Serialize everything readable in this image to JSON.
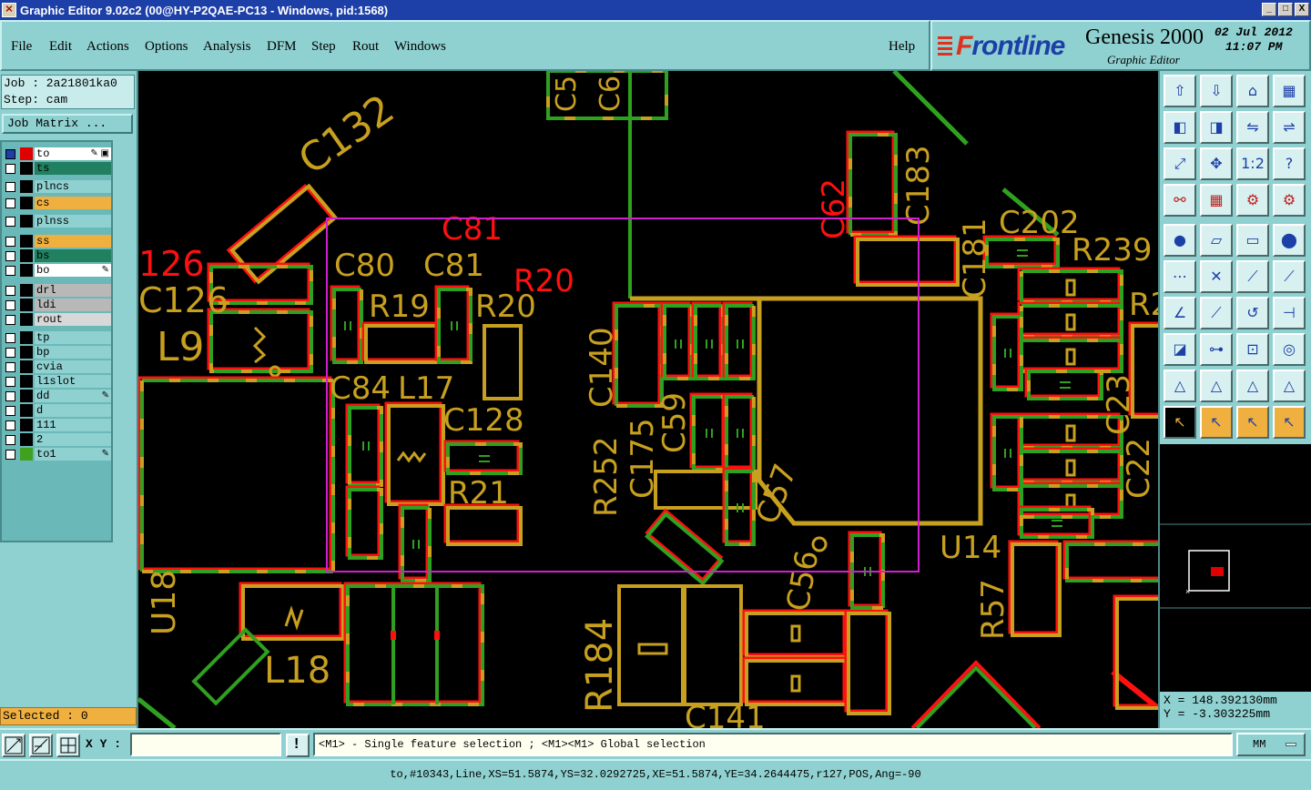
{
  "window": {
    "title": "Graphic Editor 9.02c2 (00@HY-P2QAE-PC13 - Windows, pid:1568)",
    "buttons": [
      "_",
      "□",
      "X"
    ]
  },
  "menu": {
    "file": "File",
    "edit": "Edit",
    "actions": "Actions",
    "options": "Options",
    "analysis": "Analysis",
    "dfm": "DFM",
    "step": "Step",
    "rout": "Rout",
    "windows": "Windows",
    "help": "Help"
  },
  "logo": {
    "brand_f": "F",
    "brand_rest": "rontline",
    "product": "Genesis 2000",
    "subtitle": "Graphic Editor",
    "date": "02 Jul 2012",
    "time": "11:07 PM"
  },
  "job": {
    "job_line": "Job : 2a21801ka0",
    "step_line": "Step: cam",
    "matrix_button": "Job Matrix ..."
  },
  "layers": [
    {
      "name": "to",
      "color": "#ffffff",
      "checked": true,
      "chip": "#e00000",
      "flag": "✎ ▣"
    },
    {
      "name": "ts",
      "color": "#208060",
      "checked": false,
      "chip": "",
      "flag": ""
    },
    {
      "name": "plncs",
      "color": "#8fd0d0",
      "checked": false,
      "chip": "",
      "flag": ""
    },
    {
      "name": "cs",
      "color": "#f0b040",
      "checked": false,
      "chip": "",
      "flag": ""
    },
    {
      "name": "plnss",
      "color": "#8fd0d0",
      "checked": false,
      "chip": "",
      "flag": ""
    },
    {
      "name": "ss",
      "color": "#f0b040",
      "checked": false,
      "chip": "",
      "flag": ""
    },
    {
      "name": "bs",
      "color": "#208060",
      "checked": false,
      "chip": "",
      "flag": ""
    },
    {
      "name": "bo",
      "color": "#ffffff",
      "checked": false,
      "chip": "",
      "flag": "✎"
    },
    {
      "name": "drl",
      "color": "#b8b8b8",
      "checked": false,
      "chip": "",
      "flag": ""
    },
    {
      "name": "ldi",
      "color": "#b8b8b8",
      "checked": false,
      "chip": "",
      "flag": ""
    },
    {
      "name": "rout",
      "color": "#d8d8d8",
      "checked": false,
      "chip": "",
      "flag": ""
    },
    {
      "name": "tp",
      "color": "#8fd0d0",
      "checked": false,
      "chip": "",
      "flag": ""
    },
    {
      "name": "bp",
      "color": "#8fd0d0",
      "checked": false,
      "chip": "",
      "flag": ""
    },
    {
      "name": "cvia",
      "color": "#8fd0d0",
      "checked": false,
      "chip": "",
      "flag": ""
    },
    {
      "name": "l1slot",
      "color": "#8fd0d0",
      "checked": false,
      "chip": "",
      "flag": ""
    },
    {
      "name": "dd",
      "color": "#8fd0d0",
      "checked": false,
      "chip": "",
      "flag": "✎"
    },
    {
      "name": "d",
      "color": "#8fd0d0",
      "checked": false,
      "chip": "",
      "flag": ""
    },
    {
      "name": "111",
      "color": "#8fd0d0",
      "checked": false,
      "chip": "",
      "flag": ""
    },
    {
      "name": "2",
      "color": "#8fd0d0",
      "checked": false,
      "chip": "",
      "flag": ""
    },
    {
      "name": "to1",
      "color": "#8fd0d0",
      "checked": false,
      "chip": "#40a020",
      "flag": "✎"
    }
  ],
  "selected": "Selected : 0",
  "designators": {
    "c132": "C132",
    "c81_red": "C81",
    "c80": "C80",
    "c81": "C81",
    "r20_red": "R20",
    "r19": "R19",
    "r20": "R20",
    "c126_red": "126",
    "c126": "C126",
    "l9": "L9",
    "c84": "C84",
    "l17": "L17",
    "c128": "C128",
    "r21": "R21",
    "c140": "C140",
    "r252": "R252",
    "c175": "C175",
    "c59": "C59",
    "c57": "C57",
    "c56": "C56",
    "c183": "C183",
    "c62": "C62",
    "c181": "C181",
    "c202": "C202",
    "r239": "R239",
    "u14": "U14",
    "r57": "R57",
    "r184": "R184",
    "u18": "U18",
    "l18": "L18",
    "c141": "C141",
    "c23": "C23",
    "c22": "C22",
    "c5": "C5",
    "c6": "C6",
    "r2": "R2"
  },
  "coords": {
    "x": "X = 148.392130mm",
    "y": "Y = -3.303225mm"
  },
  "cmd": {
    "xy_label": "X Y :",
    "xy_value": "",
    "hint": "<M1> - Single feature selection ; <M1><M1> Global selection",
    "units": "MM",
    "warn": "!"
  },
  "status": "to,#10343,Line,XS=51.5874,YS=32.0292725,XE=51.5874,YE=34.2644475,r127,POS,Ang=-90",
  "colors": {
    "red": "#ff1010",
    "green": "#30a020",
    "gold": "#c8a020",
    "selection": "#d020d0"
  },
  "tools": [
    "page-up-icon",
    "page-down-icon",
    "home-icon",
    "window-icon",
    "pan-left-icon",
    "pan-right-icon",
    "mirror-icon",
    "rotate-icon",
    "fit-icon",
    "zoom-fit-icon",
    "scale-icon",
    "help-icon",
    "measure-tool-icon",
    "grid-icon",
    "layers-icon",
    "layers-alt-icon",
    "pad-icon",
    "rect-icon",
    "ruler-icon",
    "circle-icon",
    "net-icon",
    "cross-icon",
    "connect-icon",
    "connect-alt-icon",
    "line-icon",
    "line-alt-icon",
    "arc-icon",
    "filter-icon",
    "surface-icon",
    "split-icon",
    "snap-icon",
    "cluster-icon",
    "edit-polygon-icon",
    "edit-polygon-alt-icon",
    "edit-polygon-b-icon",
    "edit-polygon-c-icon",
    "select-icon",
    "select-alt-icon",
    "select-rotate-icon",
    "select-route-icon"
  ]
}
